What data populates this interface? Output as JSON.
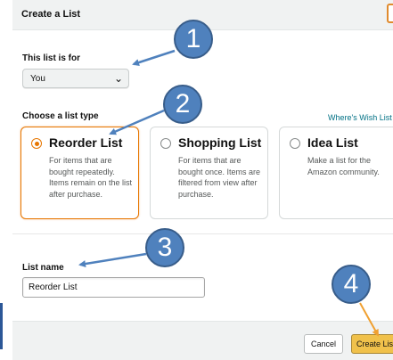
{
  "dialog": {
    "title": "Create a List"
  },
  "list_for": {
    "label": "This list is for",
    "selected": "You"
  },
  "list_type": {
    "label": "Choose a list type",
    "help_link": "Where's Wish List",
    "options": [
      {
        "title": "Reorder List",
        "description": "For items that are bought repeatedly. Items remain on the list after purchase.",
        "selected": true
      },
      {
        "title": "Shopping List",
        "description": "For items that are bought once. Items are filtered from view after purchase.",
        "selected": false
      },
      {
        "title": "Idea List",
        "description": "Make a list for the Amazon community.",
        "selected": false
      }
    ]
  },
  "list_name": {
    "label": "List name",
    "value": "Reorder List"
  },
  "footer": {
    "cancel_label": "Cancel",
    "create_label": "Create List"
  },
  "callouts": [
    "1",
    "2",
    "3",
    "4"
  ],
  "colors": {
    "accent": "#e77600",
    "callout": "#4f81bd",
    "primary_button": "#f0c14b",
    "link": "#007185"
  },
  "icons": {
    "select": "chevron-down-icon",
    "radio_selected": "radio-checked-icon",
    "radio_unselected": "radio-unchecked-icon"
  }
}
